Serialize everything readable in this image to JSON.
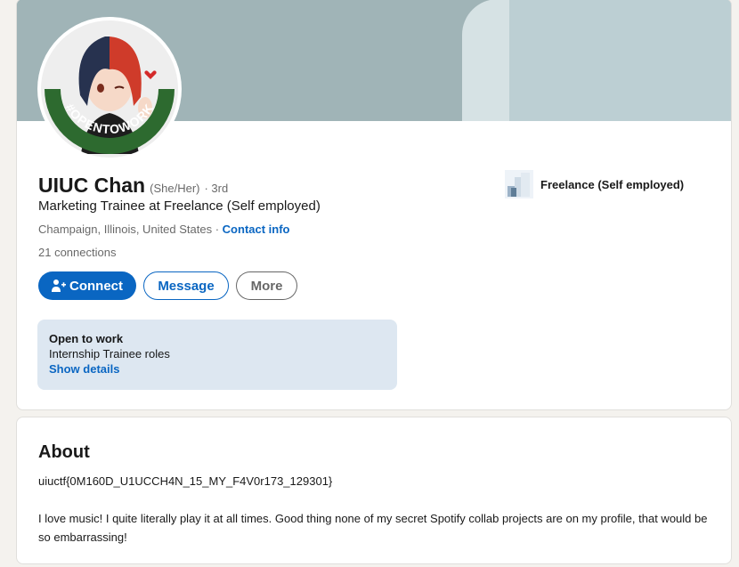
{
  "profile": {
    "name": "UIUC Chan",
    "pronouns": "(She/Her)",
    "degree": "· 3rd",
    "headline": "Marketing Trainee at Freelance (Self employed)",
    "location": "Champaign, Illinois, United States ·",
    "contact_info": "Contact info",
    "connections": "21 connections",
    "avatar_frame_text": "#OPENTOWORK",
    "avatar_frame_color": "#2d6a2f"
  },
  "actions": {
    "connect_label": "Connect",
    "message_label": "Message",
    "more_label": "More",
    "connect_icon": "add-person-icon"
  },
  "experience": {
    "company": "Freelance (Self employed)",
    "logo_icon": "company-logo-icon"
  },
  "open_to_work": {
    "title": "Open to work",
    "roles": "Internship Trainee roles",
    "details_link": "Show details"
  },
  "about": {
    "title": "About",
    "flag": "uiuctf{0M160D_U1UCCH4N_15_MY_F4V0r173_129301}",
    "body": "I love music! I quite literally play it at all times. Good thing none of my secret Spotify collab projects are on my profile, that would be so embarrassing!"
  },
  "colors": {
    "accent": "#0a66c2",
    "banner": "#a0b4b7",
    "open_to_work_bg": "#dde7f1"
  }
}
